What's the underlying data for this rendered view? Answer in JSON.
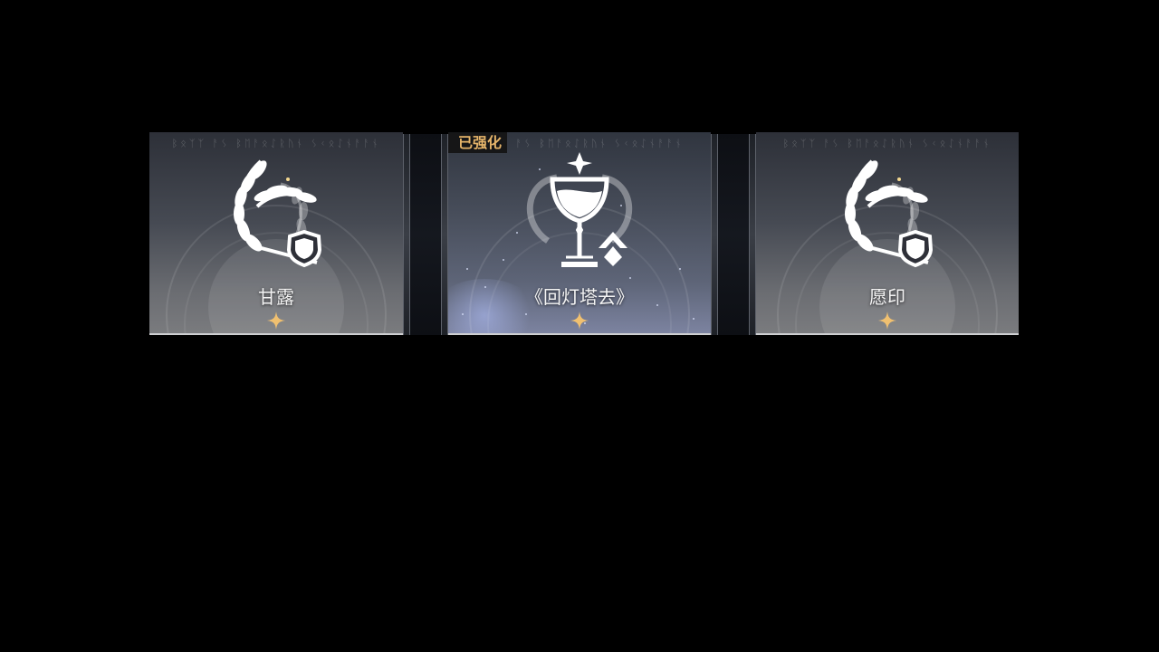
{
  "cards": [
    {
      "title": "甘露",
      "icon": "laurel-shield-icon",
      "runes": "ᛒᛟᛉᛉ ᚨᛊ ᛒᛖᚨᛟᛇᚱᚢᚾ ᛊᚲᛟᛇᚾᚨᚨᚾ"
    },
    {
      "title": "《回灯塔去》",
      "icon": "chalice-upgrade-icon",
      "runes": "ᛒᛟᛉᛉ ᚨᛊ ᛒᛖᚨᛟᛇᚱᚢᚾ ᛊᚲᛟᛇᚾᚨᚨᚾ",
      "badge": "已强化"
    },
    {
      "title": "愿印",
      "icon": "laurel-shield-icon",
      "runes": "ᛒᛟᛉᛉ ᚨᛊ ᛒᛖᚨᛟᛇᚱᚢᚾ ᛊᚲᛟᛇᚾᚨᚨᚾ"
    }
  ],
  "colors": {
    "badge_text": "#e6b56a",
    "star": "#f0c070",
    "background": "#000000"
  }
}
